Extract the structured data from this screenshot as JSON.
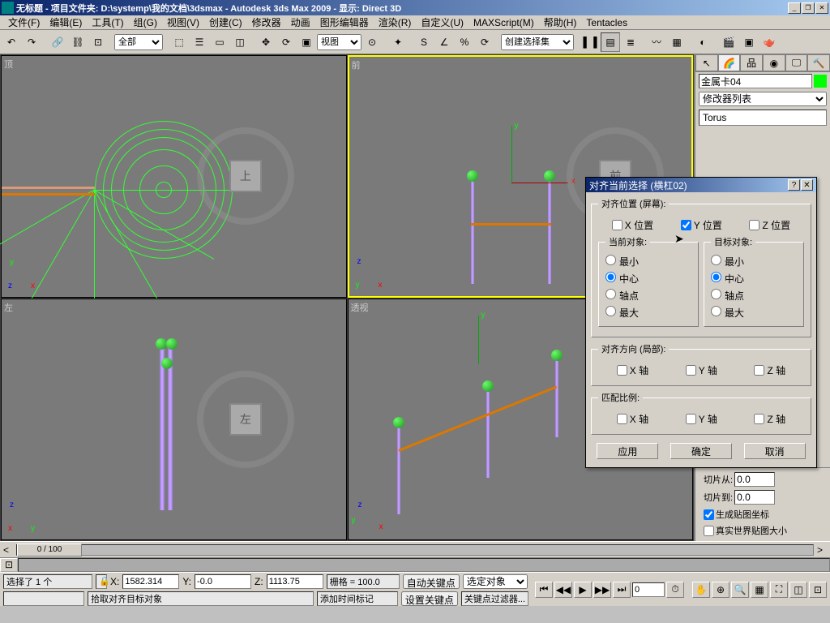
{
  "title": "无标题    - 项目文件夹: D:\\systemp\\我的文档\\3dsmax    - Autodesk 3ds Max  2009    - 显示: Direct 3D",
  "menu": [
    "文件(F)",
    "编辑(E)",
    "工具(T)",
    "组(G)",
    "视图(V)",
    "创建(C)",
    "修改器",
    "动画",
    "图形编辑器",
    "渲染(R)",
    "自定义(U)",
    "MAXScript(M)",
    "帮助(H)",
    "Tentacles"
  ],
  "toolbar": {
    "select_filter": "全部",
    "selection_set": "创建选择集"
  },
  "viewports": {
    "top": "顶",
    "front": "前",
    "left": "左",
    "persp": "透视"
  },
  "navcube": {
    "top": "上",
    "front": "前",
    "left": "左"
  },
  "cmdpanel": {
    "object_name": "金属卡04",
    "modifier_list": "修改器列表",
    "stack_item": "Torus",
    "slice_from_lbl": "切片从:",
    "slice_from_val": "0.0",
    "slice_to_lbl": "切片到:",
    "slice_to_val": "0.0",
    "gen_uv": "生成贴图坐标",
    "real_world": "真实世界贴图大小",
    "object_color": "#00ff00"
  },
  "dialog": {
    "title": "对齐当前选择 (横杠02)",
    "grp_pos": "对齐位置 (屏幕):",
    "x_pos": "X 位置",
    "y_pos": "Y 位置",
    "z_pos": "Z 位置",
    "x_pos_chk": false,
    "y_pos_chk": true,
    "z_pos_chk": false,
    "cur_obj": "当前对象:",
    "tgt_obj": "目标对象:",
    "opt_min": "最小",
    "opt_center": "中心",
    "opt_pivot": "轴点",
    "opt_max": "最大",
    "cur_sel": "中心",
    "tgt_sel": "中心",
    "grp_orient": "对齐方向 (局部):",
    "x_axis": "X 轴",
    "y_axis": "Y 轴",
    "z_axis": "Z 轴",
    "grp_scale": "匹配比例:",
    "btn_apply": "应用",
    "btn_ok": "确定",
    "btn_cancel": "取消"
  },
  "timeslider": {
    "frame": "0 / 100"
  },
  "status": {
    "sel_info": "选择了 1 个",
    "x_lbl": "X:",
    "x_val": "1582.314",
    "y_lbl": "Y:",
    "y_val": "-0.0",
    "z_lbl": "Z:",
    "z_val": "1113.75",
    "grid_lbl": "栅格 = 100.0",
    "autokey": "自动关键点",
    "selected": "选定对象",
    "prompt": "拾取对齐目标对象",
    "add_time": "添加时间标记",
    "set_key": "设置关键点",
    "key_filter": "关键点过滤器..."
  }
}
